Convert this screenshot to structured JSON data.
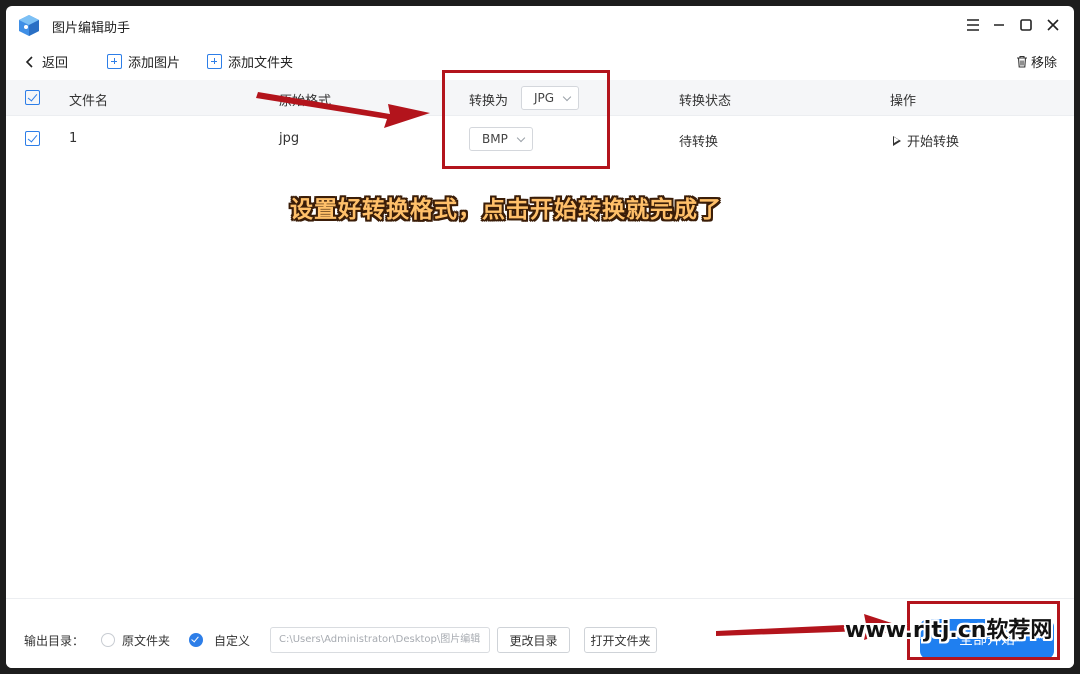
{
  "window": {
    "title": "图片编辑助手"
  },
  "toolbar": {
    "back_label": "返回",
    "add_image_label": "添加图片",
    "add_folder_label": "添加文件夹",
    "remove_label": "移除"
  },
  "table": {
    "headers": {
      "filename": "文件名",
      "original_format": "原始格式",
      "convert_to": "转换为",
      "convert_to_value": "JPG",
      "status": "转换状态",
      "action": "操作"
    },
    "rows": [
      {
        "filename": "1",
        "original_format": "jpg",
        "target_format": "BMP",
        "status": "待转换",
        "action": "开始转换"
      }
    ]
  },
  "annotation": {
    "caption": "设置好转换格式，点击开始转换就完成了",
    "arrow_color": "#b3141c"
  },
  "footer": {
    "output_label": "输出目录：",
    "option_original": "原文件夹",
    "option_custom": "自定义",
    "path_value": "C:\\Users\\Administrator\\Desktop\\图片编辑",
    "change_dir_label": "更改目录",
    "open_folder_label": "打开文件夹",
    "start_all_label": "全部开始"
  },
  "watermark": "www.rjtj.cn软荐网",
  "colors": {
    "accent": "#2d7ee8",
    "primary_button": "#1f7ff0",
    "highlight": "#b3141c"
  }
}
